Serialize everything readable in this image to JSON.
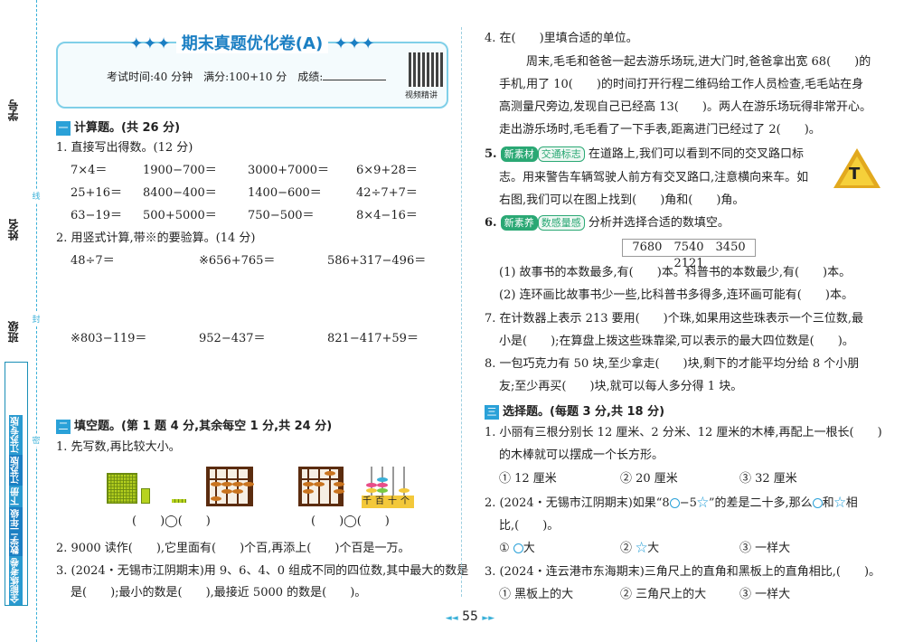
{
  "sidebar": {
    "xuehao": "学号",
    "xingming": "姓名",
    "banji": "班级",
    "book_parts": [
      "全能练考卷",
      "数学二年级",
      "下册",
      "江苏版",
      "江苏专版"
    ],
    "cut_marks": [
      "线",
      "封",
      "密"
    ]
  },
  "header": {
    "title": "期末真题优化卷(A)",
    "info": "考试时间:40 分钟　满分:100+10 分　成绩:",
    "qr_label": "视频精讲"
  },
  "sec1": {
    "num": "一",
    "title": "计算题。(共 26 分)",
    "q1": "1. 直接写出得数。(12 分)",
    "q1_rows": [
      [
        "7×4＝",
        "1900−700＝",
        "3000+7000＝",
        "6×9+28＝"
      ],
      [
        "25+16＝",
        "8400−400＝",
        "1400−600＝",
        "42÷7+7＝"
      ],
      [
        "63−19＝",
        "500+5000＝",
        "750−500＝",
        "8×4−16＝"
      ]
    ],
    "q2": "2. 用竖式计算,带※的要验算。(14 分)",
    "q2_rows": [
      [
        "48÷7＝",
        "※656+765＝",
        "586+317−496＝"
      ],
      [
        "※803−119＝",
        "952−437＝",
        "821−417+59＝"
      ]
    ]
  },
  "sec2": {
    "num": "二",
    "title": "填空题。(第 1 题 4 分,其余每空 1 分,共 24 分)",
    "q1": "1. 先写数,再比较大小。",
    "cmp": [
      "(　　)◯(　　)",
      "(　　)◯(　　)"
    ],
    "rod_labels": "千百十个",
    "q2": "2. 9000 读作(　　),它里面有(　　)个百,再添上(　　)个百是一万。",
    "q3a": "3. (2024・无锡市江阴期末)用 9、6、4、0 组成不同的四位数,其中最大的数是",
    "q3b": "是(　　);最小的数是(　　),最接近 5000 的数是(　　)。"
  },
  "right": {
    "q4": "4. 在(　　)里填合适的单位。",
    "q4_lines": [
      "周末,毛毛和爸爸一起去游乐场玩,进大门时,爸爸拿出宽 68(　　)的",
      "手机,用了 10(　　)的时间打开行程二维码给工作人员检查,毛毛站在身",
      "高测量尺旁边,发现自己已经高 13(　　)。两人在游乐场玩得非常开心。",
      "走出游乐场时,毛毛看了一下手表,距离进门已经过了 2(　　)。"
    ],
    "q5_num": "5.",
    "q5_badge1": "新素材",
    "q5_badge2": "交通标志",
    "q5_text": "在道路上,我们可以看到不同的交叉路口标",
    "q5_lines": [
      "志。用来警告车辆驾驶人前方有交叉路口,注意横向来车。如",
      "右图,我们可以在图上找到(　　)角和(　　)角。"
    ],
    "sign_letter": "T",
    "q6_num": "6.",
    "q6_badge1": "新素养",
    "q6_badge2": "数感量感",
    "q6_text": "分析并选择合适的数填空。",
    "numbers": "7680　7540　3450　2121",
    "q6_lines": [
      "(1) 故事书的本数最多,有(　　)本。科普书的本数最少,有(　　)本。",
      "(2) 连环画比故事书少一些,比科普书多得多,连环画可能有(　　)本。"
    ],
    "q7": [
      "7. 在计数器上表示 213 要用(　　)个珠,如果用这些珠表示一个三位数,最",
      "小是(　　);在算盘上拨这些珠靠梁,可以表示的最大四位数是(　　)。"
    ],
    "q8": [
      "8. 一包巧克力有 50 块,至少拿走(　　)块,剩下的才能平均分给 8 个小朋",
      "友;至少再买(　　)块,就可以每人多分得 1 块。"
    ],
    "sec3_num": "三",
    "sec3_title": "选择题。(每题 3 分,共 18 分)",
    "c1": [
      "1. 小丽有三根分别长 12 厘米、2 分米、12 厘米的木棒,再配上一根长(　　)",
      "的木棒就可以摆成一个长方形。"
    ],
    "c1_opts": [
      "① 12 厘米",
      "② 20 厘米",
      "③ 32 厘米"
    ],
    "c2a": "2. (2024・无锡市江阴期末)如果“8",
    "c2b": "−5",
    "c2c": "”的差是二十多,那么",
    "c2d": "和",
    "c2e": "相",
    "c2f": "比,(　　)。",
    "c2_opts": [
      "①",
      "大",
      "②",
      "大",
      "③ 一样大"
    ],
    "c3": "3. (2024・连云港市东海期末)三角尺上的直角和黑板上的直角相比,(　　)。",
    "c3_opts": [
      "① 黑板上的大",
      "② 三角尺上的大",
      "③ 一样大"
    ]
  },
  "page": {
    "number": "55"
  }
}
